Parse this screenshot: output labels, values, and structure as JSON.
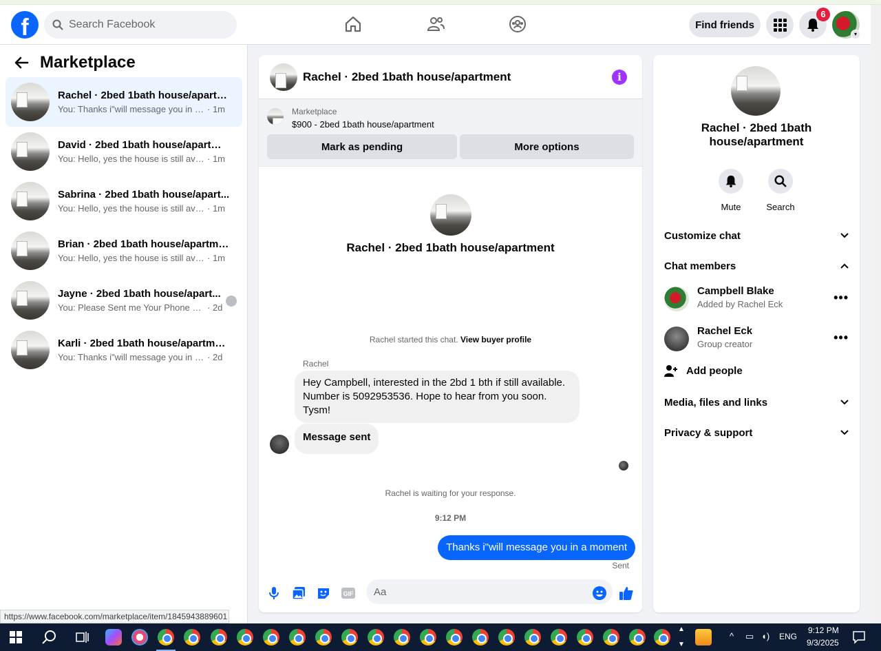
{
  "header": {
    "logo": "f",
    "search_placeholder": "Search Facebook",
    "find_friends": "Find friends",
    "notification_count": "6"
  },
  "sidebar": {
    "title": "Marketplace",
    "conversations": [
      {
        "name": "Rachel · 2bed 1bath house/apartm...",
        "preview": "You: Thanks i\"will message you in a ...",
        "time": "· 1m"
      },
      {
        "name": "David · 2bed 1bath house/apartme...",
        "preview": "You: Hello, yes the house is still availa...",
        "time": "· 1m"
      },
      {
        "name": "Sabrina · 2bed 1bath house/apart...",
        "preview": "You: Hello, yes the house is still availa...",
        "time": "· 1m"
      },
      {
        "name": "Brian · 2bed 1bath house/apartment",
        "preview": "You: Hello, yes the house is still availa...",
        "time": "· 1m"
      },
      {
        "name": "Jayne · 2bed 1bath house/apart...",
        "preview": "You: Please Sent me Your Phone N...",
        "time": "· 2d"
      },
      {
        "name": "Karli · 2bed 1bath house/apartment",
        "preview": "You: Thanks i\"will message you in a m...",
        "time": "· 2d"
      }
    ]
  },
  "chat": {
    "title": "Rachel · 2bed 1bath house/apartment",
    "listing_source": "Marketplace",
    "listing_price": "$900 - 2bed 1bath house/apartment",
    "mark_pending": "Mark as pending",
    "more_options": "More options",
    "intro_name": "Rachel · 2bed 1bath house/apartment",
    "started_text": "Rachel started this chat.",
    "view_buyer": "View buyer profile",
    "sender_label": "Rachel",
    "incoming_message": "Hey Campbell, interested in the 2bd 1 bth if still available. Number is 5092953536. Hope to hear from you soon. Tysm!",
    "incoming_message_2": "Message sent",
    "waiting": "Rachel is waiting for your response.",
    "timestamp": "9:12 PM",
    "outgoing_message": "Thanks i\"will message you in a moment",
    "sent_status": "Sent",
    "input_placeholder": "Aa"
  },
  "info_panel": {
    "name": "Rachel · 2bed 1bath house/apartment",
    "mute": "Mute",
    "search": "Search",
    "customize_chat": "Customize chat",
    "chat_members": "Chat members",
    "members": [
      {
        "name": "Campbell Blake",
        "sub": "Added by Rachel Eck"
      },
      {
        "name": "Rachel Eck",
        "sub": "Group creator"
      }
    ],
    "add_people": "Add people",
    "media": "Media, files and links",
    "privacy": "Privacy & support"
  },
  "status_url": "https://www.facebook.com/marketplace/item/1845943889601",
  "taskbar": {
    "lang": "ENG",
    "time": "9:12 PM",
    "date": "9/3/2025"
  },
  "colors": {
    "brand_blue": "#0866ff",
    "active_row": "#ebf5ff",
    "badge_red": "#e41e3f",
    "info_purple": "#a033ff"
  }
}
